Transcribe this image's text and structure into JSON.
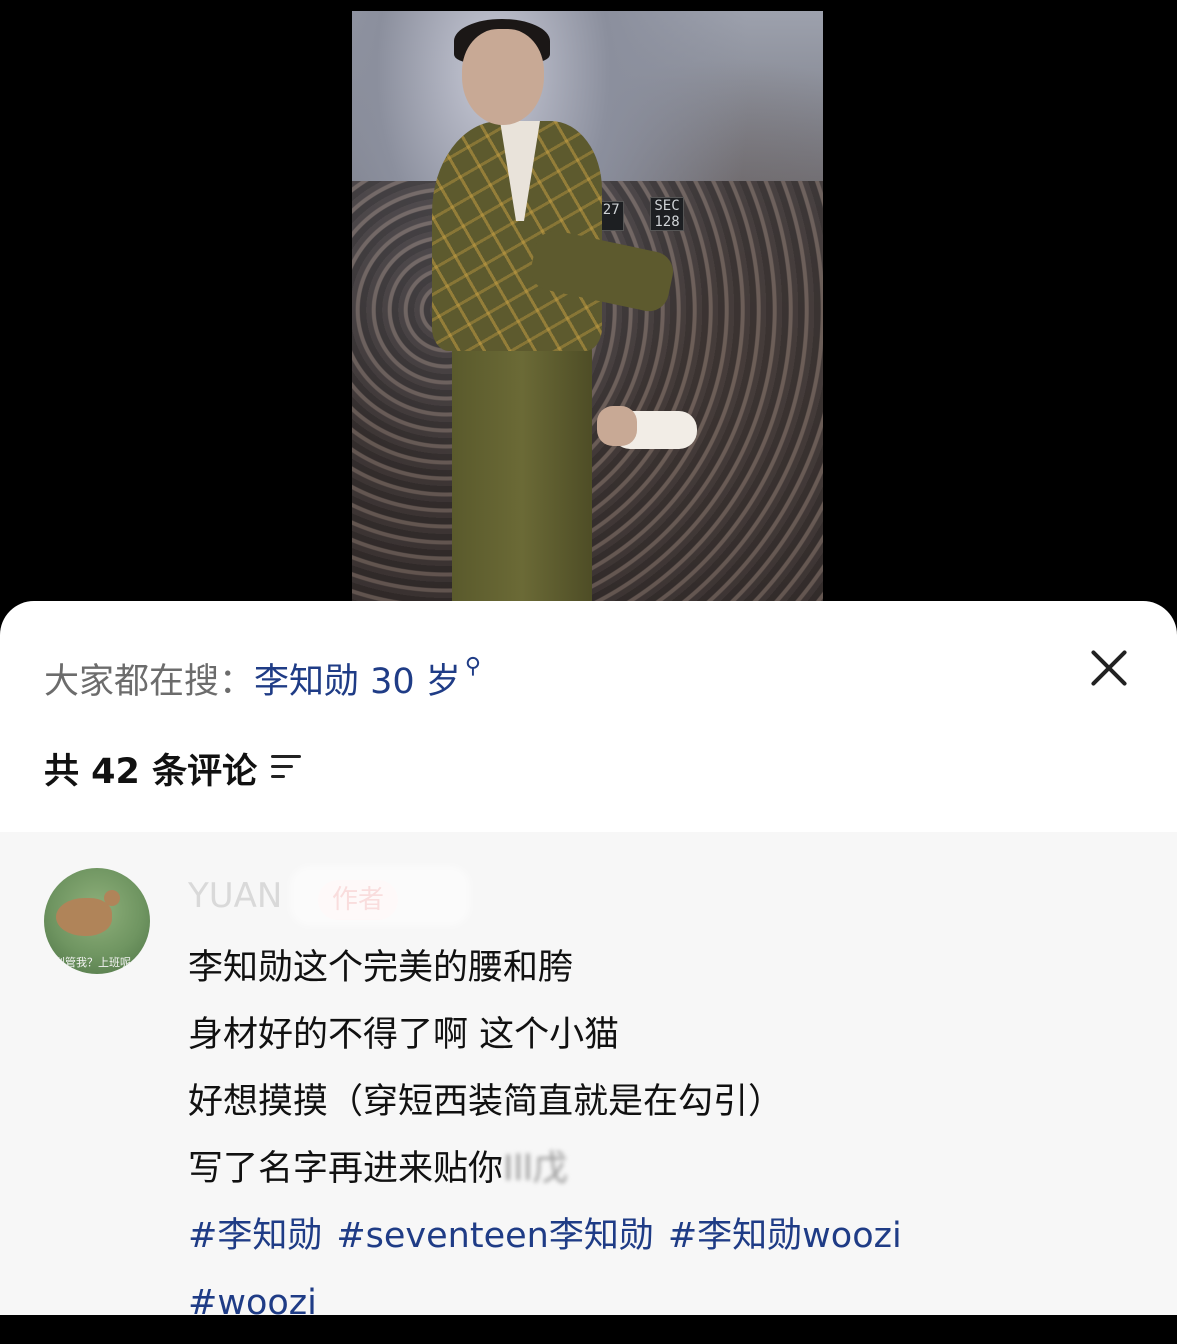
{
  "video": {
    "seat_signs": [
      "127",
      "SEC 128"
    ]
  },
  "search_bar": {
    "label": "大家都在搜：",
    "term": "李知勋 30 岁",
    "search_icon": "search-icon"
  },
  "close": {
    "icon": "close-icon"
  },
  "comments_header": {
    "count_text": "共 42 条评论",
    "sort_icon": "sort-icon"
  },
  "comments": [
    {
      "username": "YUAN",
      "badge": "作者",
      "avatar_caption": "别管我？上班呢",
      "lines": [
        "李知勋这个完美的腰和胯",
        "身材好的不得了啊 这个小猫",
        "好想摸摸（穿短西装简直就是在勾引）",
        "写了名字再进来贴你"
      ],
      "blurred_suffix": "Ill戊",
      "hashtags": [
        "#李知勋",
        "#seventeen李知勋",
        "#李知勋woozi",
        "#woozi"
      ]
    }
  ]
}
